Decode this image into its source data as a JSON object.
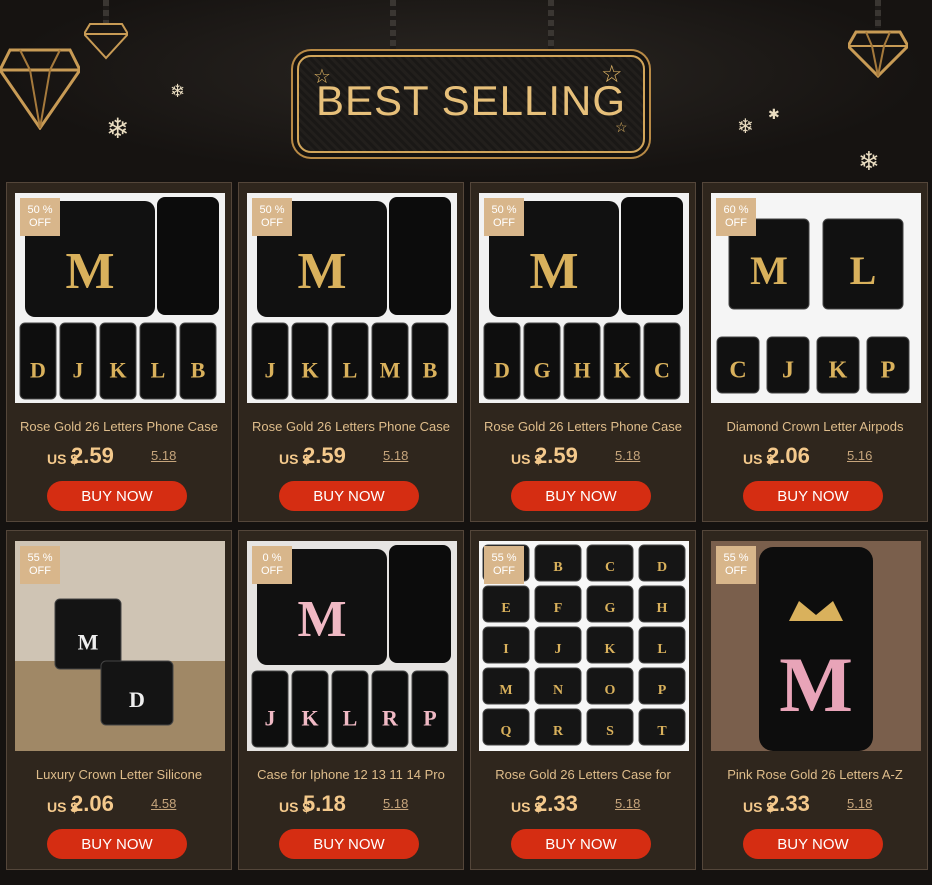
{
  "banner": {
    "title": "BEST SELLING"
  },
  "products": [
    {
      "badge_pct": "50 %",
      "badge_off": "OFF",
      "title": "Rose  Gold 26 Letters Phone Case",
      "currency": "US $",
      "price": "2.59",
      "old_price": "5.18",
      "buy_label": "BUY NOW",
      "image_letters": [
        "D",
        "J",
        "K",
        "L",
        "B"
      ],
      "hero_letter": "M",
      "thumbnail": "phone-cases"
    },
    {
      "badge_pct": "50 %",
      "badge_off": "OFF",
      "title": "Rose  Gold 26 Letters Phone Case",
      "currency": "US $",
      "price": "2.59",
      "old_price": "5.18",
      "buy_label": "BUY NOW",
      "image_letters": [
        "J",
        "K",
        "L",
        "M",
        "B"
      ],
      "hero_letter": "M",
      "thumbnail": "phone-cases"
    },
    {
      "badge_pct": "50 %",
      "badge_off": "OFF",
      "title": "Rose  Gold 26 Letters Phone Case",
      "currency": "US $",
      "price": "2.59",
      "old_price": "5.18",
      "buy_label": "BUY NOW",
      "image_letters": [
        "D",
        "G",
        "H",
        "K",
        "C"
      ],
      "hero_letter": "M",
      "thumbnail": "phone-cases"
    },
    {
      "badge_pct": "60 %",
      "badge_off": "OFF",
      "title": "Diamond Crown Letter Airpods",
      "currency": "US $",
      "price": "2.06",
      "old_price": "5.16",
      "buy_label": "BUY NOW",
      "image_letters": [
        "C",
        "J",
        "K",
        "P"
      ],
      "hero_letter": "M",
      "thumbnail": "airpods-cases"
    },
    {
      "badge_pct": "55 %",
      "badge_off": "OFF",
      "title": "Luxury Crown Letter Silicone",
      "currency": "US $",
      "price": "2.06",
      "old_price": "4.58",
      "buy_label": "BUY NOW",
      "image_letters": [
        "M",
        "D"
      ],
      "hero_letter": "M",
      "thumbnail": "airpods-lifestyle"
    },
    {
      "badge_pct": "0 %",
      "badge_off": "OFF",
      "title": "Case for  Iphone 12 13 11 14 Pro",
      "currency": "US $",
      "price": "5.18",
      "old_price": "5.18",
      "buy_label": "BUY NOW",
      "image_letters": [
        "J",
        "K",
        "L",
        "R",
        "P"
      ],
      "hero_letter": "M",
      "thumbnail": "floral-phone-cases"
    },
    {
      "badge_pct": "55 %",
      "badge_off": "OFF",
      "title": "Rose  Gold 26 Letters Case for",
      "currency": "US $",
      "price": "2.33",
      "old_price": "5.18",
      "buy_label": "BUY NOW",
      "image_letters": [
        "B",
        "C",
        "D",
        "E",
        "F",
        "G",
        "H",
        "I",
        "J",
        "K",
        "L",
        "M",
        "N",
        "O",
        "P",
        "Q",
        "R",
        "S",
        "T"
      ],
      "hero_letter": "",
      "thumbnail": "airpods-grid"
    },
    {
      "badge_pct": "55 %",
      "badge_off": "OFF",
      "title": "Pink Rose  Gold 26 Letters A-Z",
      "currency": "US $",
      "price": "2.33",
      "old_price": "5.18",
      "buy_label": "BUY NOW",
      "image_letters": [],
      "hero_letter": "M",
      "thumbnail": "pink-phone-case"
    }
  ],
  "colors": {
    "accent": "#d52d12",
    "gold": "#e7c07a",
    "card_bg": "#2f261d",
    "page_bg": "#151210"
  }
}
